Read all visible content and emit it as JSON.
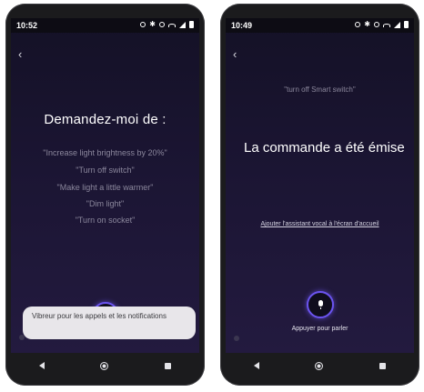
{
  "left_phone": {
    "status": {
      "time": "10:52"
    },
    "back_glyph": "‹",
    "title": "Demandez-moi de :",
    "suggestions": [
      "\"Increase light brightness by 20%\"",
      "\"Turn off switch\"",
      "\"Make light a little warmer\"",
      "\"Dim light\"",
      "\"Turn on socket\""
    ],
    "toast": "Vibreur pour les appels et les notifications"
  },
  "right_phone": {
    "status": {
      "time": "10:49"
    },
    "back_glyph": "‹",
    "spoken_command": "\"turn off Smart switch\"",
    "confirmation": "La commande a été émise",
    "add_assistant_link": "Ajouter l'assistant vocal à l'écran d'accueil",
    "press_to_talk": "Appuyer pour parler"
  },
  "colors": {
    "accent": "#6b54f0",
    "background": "#1b1533",
    "suggestion_text": "#8b879c"
  }
}
